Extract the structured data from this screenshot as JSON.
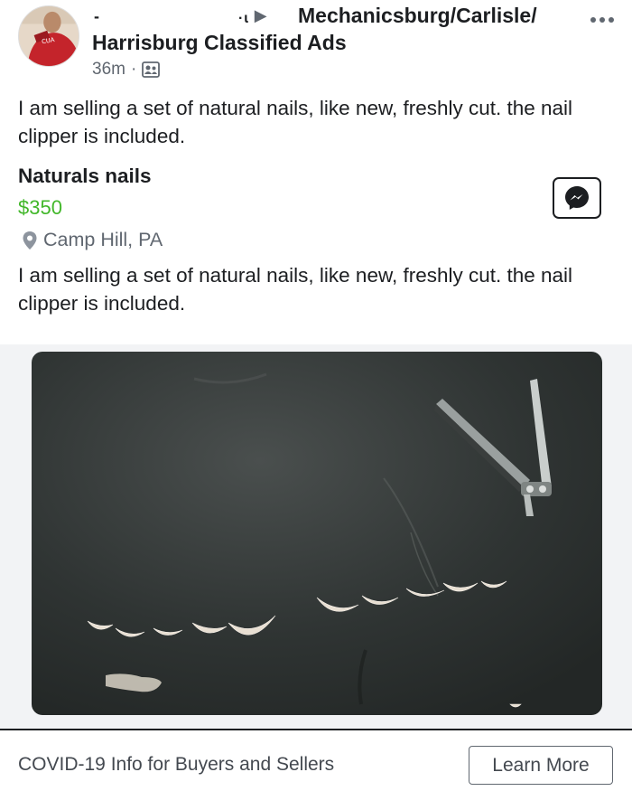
{
  "post": {
    "author_fragment": "-",
    "partial_text": "·ɩ",
    "group_line1": "Mechanicsburg/Carlisle/",
    "group_line2": "Harrisburg Classified Ads",
    "time": "36m",
    "separator": "·",
    "privacy_icon": "friends-icon",
    "more_icon": "more-dots-icon",
    "text": "I am selling a set of natural nails, like new, freshly cut.  the nail clipper is included."
  },
  "listing": {
    "title": "Naturals nails",
    "price": "$350",
    "price_color": "#42b72a",
    "location_icon": "location-pin-icon",
    "location": "Camp Hill, PA",
    "description": "I am selling a set of natural nails, like new, freshly cut.  the nail clipper is included.",
    "message_icon": "messenger-icon"
  },
  "photo": {
    "description_icon": "listing-photo"
  },
  "footer": {
    "info_text": "COVID-19 Info for Buyers and Sellers",
    "learn_more_label": "Learn More"
  }
}
